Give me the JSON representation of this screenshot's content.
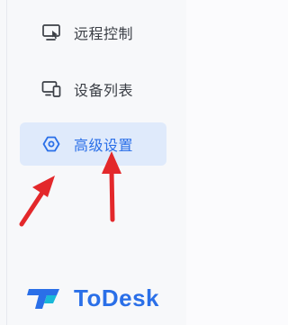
{
  "sidebar": {
    "items": [
      {
        "label": "远程控制",
        "icon": "remote-control-icon",
        "active": false
      },
      {
        "label": "设备列表",
        "icon": "device-list-icon",
        "active": false
      },
      {
        "label": "高级设置",
        "icon": "hexagon-settings-icon",
        "active": true
      }
    ]
  },
  "brand": {
    "name": "ToDesk",
    "icon": "todesk-logo-icon"
  },
  "annotations": {
    "arrow_color": "#e3282b"
  },
  "colors": {
    "accent": "#2a6fe8",
    "active_bg": "#dfeafb",
    "text": "#3b3f46"
  }
}
